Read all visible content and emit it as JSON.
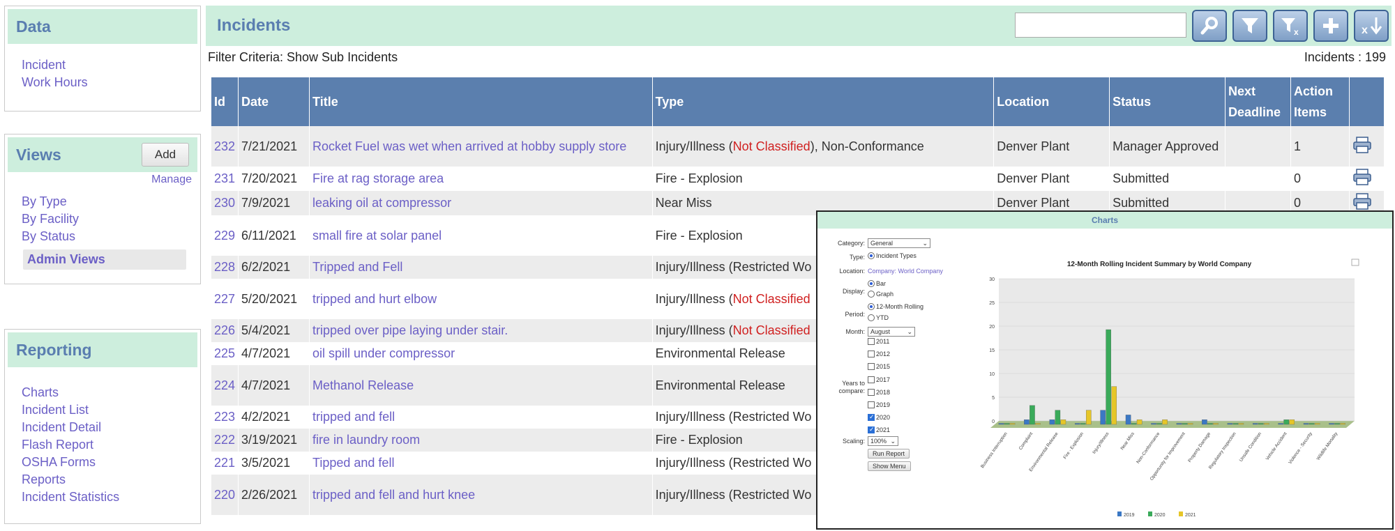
{
  "sidebar": {
    "data": {
      "title": "Data",
      "links": [
        "Incident",
        "Work Hours"
      ]
    },
    "views": {
      "title": "Views",
      "add_label": "Add",
      "manage_label": "Manage",
      "links": [
        "By Type",
        "By Facility",
        "By Status"
      ],
      "admin_label": "Admin Views"
    },
    "reporting": {
      "title": "Reporting",
      "links": [
        "Charts",
        "Incident List",
        "Incident Detail",
        "Flash Report",
        "OSHA Forms",
        "Reports",
        "Incident Statistics"
      ]
    }
  },
  "main": {
    "title": "Incidents",
    "search_value": "",
    "filter_criteria": "Filter Criteria: Show Sub Incidents",
    "count_label": "Incidents : 199",
    "toolbar_icons": [
      "search-icon",
      "filter-icon",
      "clear-filter-icon",
      "add-icon",
      "export-icon"
    ]
  },
  "table": {
    "headers": [
      "Id",
      "Date",
      "Title",
      "Type",
      "Location",
      "Status",
      "Next Deadline",
      "Action Items",
      ""
    ],
    "rows": [
      {
        "id": "232",
        "date": "7/21/2021",
        "title": "Rocket Fuel was wet when arrived at hobby supply store",
        "type_a": "Injury/Illness (",
        "type_red": "Not Classified",
        "type_b": "), Non-Conformance",
        "location": "Denver Plant",
        "status": "Manager Approved",
        "deadline": "",
        "actions": "1"
      },
      {
        "id": "231",
        "date": "7/20/2021",
        "title": "Fire at rag storage area",
        "type_a": "Fire - Explosion",
        "type_red": "",
        "type_b": "",
        "location": "Denver Plant",
        "status": "Submitted",
        "deadline": "",
        "actions": "0"
      },
      {
        "id": "230",
        "date": "7/9/2021",
        "title": "leaking oil at compressor",
        "type_a": "Near Miss",
        "type_red": "",
        "type_b": "",
        "location": "Denver Plant",
        "status": "Submitted",
        "deadline": "",
        "actions": "0"
      },
      {
        "id": "229",
        "date": "6/11/2021",
        "title": "small fire at solar panel",
        "type_a": "Fire - Explosion",
        "type_red": "",
        "type_b": "",
        "location": "",
        "status": "",
        "deadline": "",
        "actions": ""
      },
      {
        "id": "228",
        "date": "6/2/2021",
        "title": "Tripped and Fell",
        "type_a": "Injury/Illness (Restricted Wo",
        "type_red": "",
        "type_b": "",
        "location": "",
        "status": "",
        "deadline": "",
        "actions": ""
      },
      {
        "id": "227",
        "date": "5/20/2021",
        "title": "tripped and hurt elbow",
        "type_a": "Injury/Illness (",
        "type_red": "Not Classified",
        "type_b": "",
        "location": "",
        "status": "",
        "deadline": "",
        "actions": ""
      },
      {
        "id": "226",
        "date": "5/4/2021",
        "title": "tripped over pipe laying under stair.",
        "type_a": "Injury/Illness (",
        "type_red": "Not Classified",
        "type_b": "",
        "location": "",
        "status": "",
        "deadline": "",
        "actions": ""
      },
      {
        "id": "225",
        "date": "4/7/2021",
        "title": "oil spill under compressor",
        "type_a": "Environmental Release",
        "type_red": "",
        "type_b": "",
        "location": "",
        "status": "",
        "deadline": "",
        "actions": ""
      },
      {
        "id": "224",
        "date": "4/7/2021",
        "title": "Methanol Release",
        "type_a": "Environmental Release",
        "type_red": "",
        "type_b": "",
        "location": "",
        "status": "",
        "deadline": "",
        "actions": ""
      },
      {
        "id": "223",
        "date": "4/2/2021",
        "title": "tripped and fell",
        "type_a": "Injury/Illness (Restricted Wo",
        "type_red": "",
        "type_b": "",
        "location": "",
        "status": "",
        "deadline": "",
        "actions": ""
      },
      {
        "id": "222",
        "date": "3/19/2021",
        "title": "fire in laundry room",
        "type_a": "Fire - Explosion",
        "type_red": "",
        "type_b": "",
        "location": "",
        "status": "",
        "deadline": "",
        "actions": ""
      },
      {
        "id": "221",
        "date": "3/5/2021",
        "title": "Tipped and fell",
        "type_a": "Injury/Illness (Restricted Wo",
        "type_red": "",
        "type_b": "",
        "location": "",
        "status": "",
        "deadline": "",
        "actions": ""
      },
      {
        "id": "220",
        "date": "2/26/2021",
        "title": "tripped and fell and hurt knee",
        "type_a": "Injury/Illness (Restricted Wo",
        "type_red": "",
        "type_b": "",
        "location": "",
        "status": "",
        "deadline": "",
        "actions": ""
      }
    ]
  },
  "charts_panel": {
    "title": "Charts",
    "category_label": "Category:",
    "category_value": "General",
    "type_label": "Type:",
    "type_value": "Incident Types",
    "location_label": "Location:",
    "location_value": "Company: World Company",
    "display_label": "Display:",
    "display_options": [
      "Bar",
      "Graph"
    ],
    "period_label": "Period:",
    "period_options": [
      "12-Month Rolling",
      "YTD"
    ],
    "month_label": "Month:",
    "month_value": "August",
    "years_label_1": "Years to",
    "years_label_2": "compare:",
    "years": [
      {
        "year": "2011",
        "checked": false
      },
      {
        "year": "2012",
        "checked": false
      },
      {
        "year": "2015",
        "checked": false
      },
      {
        "year": "2017",
        "checked": false
      },
      {
        "year": "2018",
        "checked": false
      },
      {
        "year": "2019",
        "checked": false
      },
      {
        "year": "2020",
        "checked": true
      },
      {
        "year": "2021",
        "checked": true
      }
    ],
    "scaling_label": "Scaling:",
    "scaling_value": "100%",
    "run_label": "Run Report",
    "menu_label": "Show Menu"
  },
  "chart_data": {
    "type": "bar",
    "title": "12-Month Rolling Incident Summary by World Company",
    "categories": [
      "Business Interruption",
      "Complaint",
      "Environmental Release",
      "Fire - Explosion",
      "Injury/Illness",
      "Near Miss",
      "Non-Conformance",
      "Opportunity for Improvement",
      "Property Damage",
      "Regulatory Inspection",
      "Unsafe Condition",
      "Vehicle Accident",
      "Violence - Security",
      "Wildlife Mortality"
    ],
    "series": [
      {
        "name": "2019",
        "color": "#3b78c4",
        "values": [
          0,
          1,
          1,
          0,
          3,
          2,
          0,
          0,
          1,
          0,
          0,
          0,
          0,
          0
        ]
      },
      {
        "name": "2020",
        "color": "#3aaa5a",
        "values": [
          0,
          4,
          3,
          0,
          20,
          0,
          0,
          0,
          0,
          0,
          0,
          1,
          0,
          0
        ]
      },
      {
        "name": "2021",
        "color": "#e6c628",
        "values": [
          0,
          0,
          1,
          3,
          8,
          1,
          1,
          0,
          0,
          0,
          0,
          1,
          0,
          0
        ]
      }
    ],
    "ylim": [
      0,
      30
    ],
    "yticks": [
      0,
      5,
      10,
      15,
      20,
      25,
      30
    ],
    "legend": "bottom"
  }
}
